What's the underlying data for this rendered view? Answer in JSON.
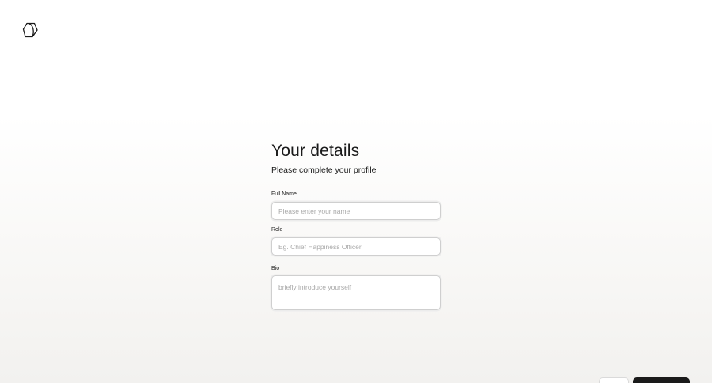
{
  "header": {
    "logo_icon": "hexagon-logo-icon"
  },
  "form": {
    "title": "Your details",
    "subtitle": "Please complete your profile",
    "fields": {
      "full_name": {
        "label": "Full Name",
        "placeholder": "Please enter your name",
        "value": ""
      },
      "role": {
        "label": "Role",
        "placeholder": "Eg. Chief Happiness Officer",
        "value": ""
      },
      "bio": {
        "label": "Bio",
        "placeholder": "briefly introduce yourself",
        "value": ""
      }
    }
  },
  "colors": {
    "primary_button": "#1a1a1a",
    "field_border": "#cfcfcf",
    "placeholder": "#a8a8a8"
  }
}
